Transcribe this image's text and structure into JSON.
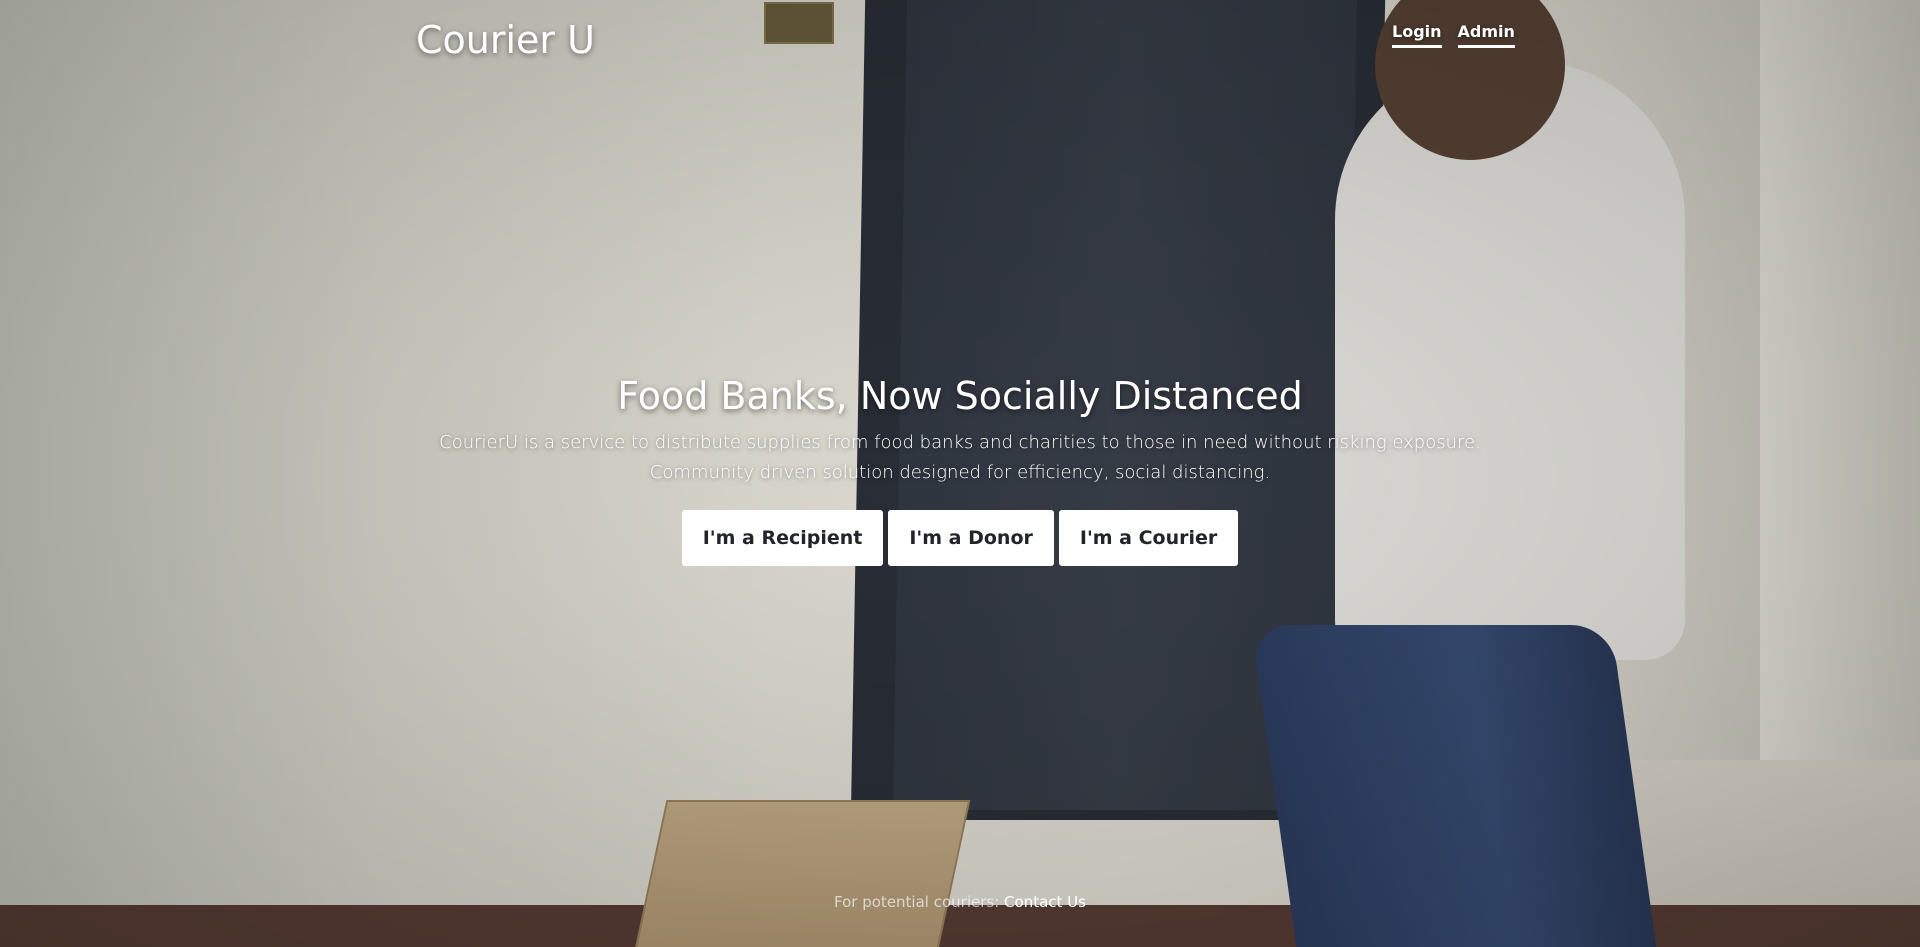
{
  "brand": {
    "name": "Courier U"
  },
  "nav": {
    "items": [
      {
        "label": "Login"
      },
      {
        "label": "Admin"
      }
    ]
  },
  "cover": {
    "headline": "Food Banks, Now Socially Distanced",
    "lead_line1": "CourierU is a service to distribute supplies from food banks and charities to those in need without risking exposure.",
    "lead_line2": "Community driven solution designed for efficiency, social distancing.",
    "buttons": [
      {
        "label": "I'm a Recipient"
      },
      {
        "label": "I'm a Donor"
      },
      {
        "label": "I'm a Courier"
      }
    ]
  },
  "footer": {
    "text": "For potential couriers:",
    "link_label": "Contact Us"
  }
}
